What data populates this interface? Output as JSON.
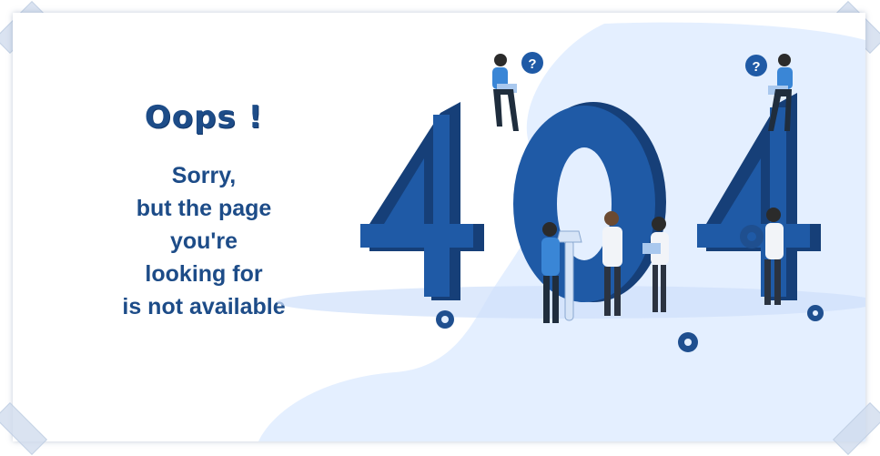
{
  "heading": "Oops !",
  "message_lines": [
    "Sorry,",
    "but the page",
    "you're",
    "looking for",
    "is not available"
  ],
  "illustration": {
    "digits": [
      "4",
      "0",
      "4"
    ],
    "bubble_glyph": "?",
    "colors": {
      "primary": "#1d4c88",
      "digit_front": "#1f5aa6",
      "digit_side": "#163f78",
      "backdrop": "#e4efff",
      "accent": "#3a86d6"
    }
  }
}
